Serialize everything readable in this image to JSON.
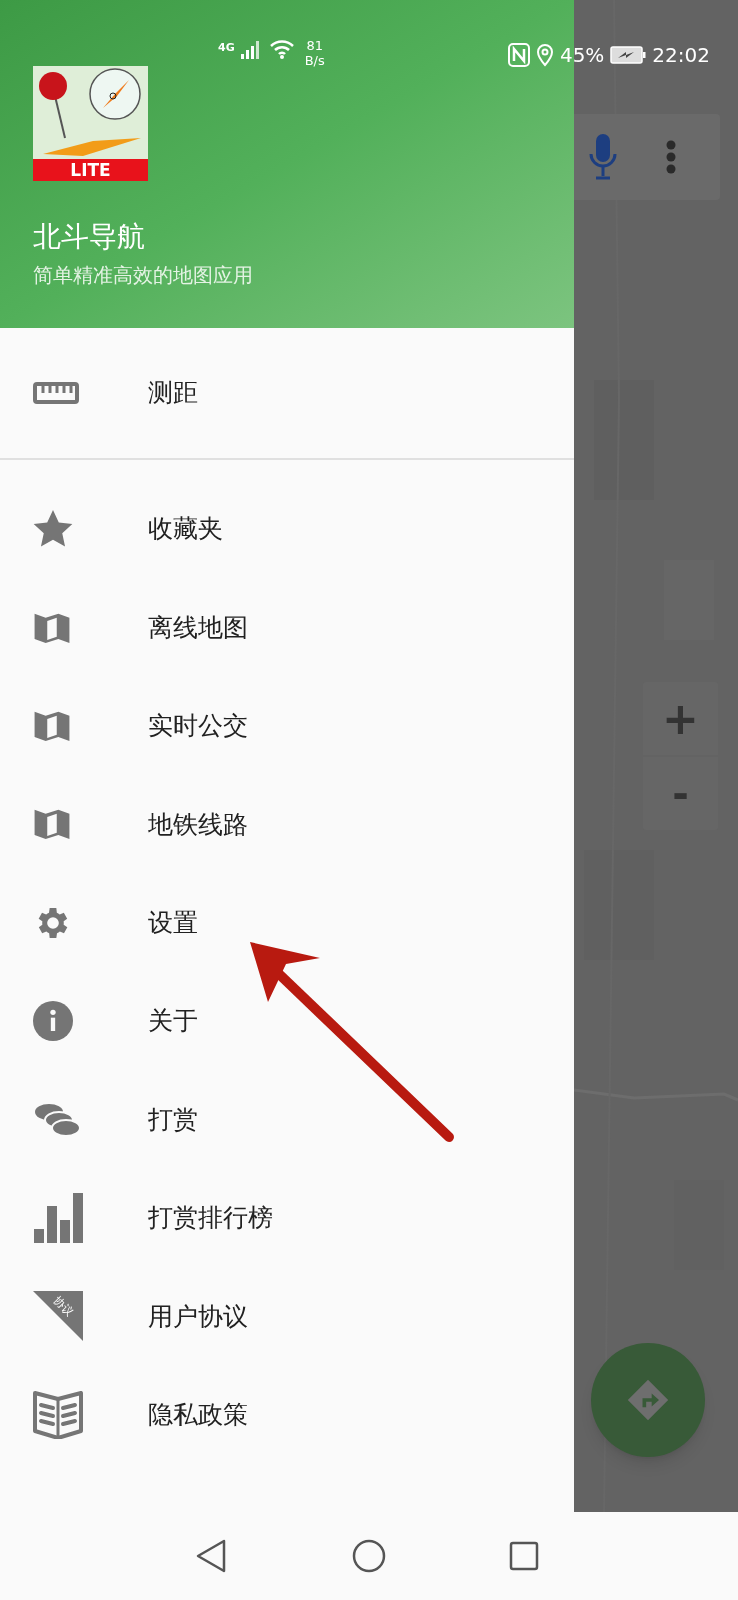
{
  "status_bar": {
    "network": "4G",
    "speed_value": "81",
    "speed_unit": "B/s",
    "battery": "45%",
    "time": "22:02"
  },
  "drawer": {
    "logo_badge": "LITE",
    "app_name": "北斗导航",
    "tagline": "简单精准高效的地图应用",
    "top_items": [
      {
        "label": "测距",
        "kind": "ruler"
      }
    ],
    "items": [
      {
        "label": "收藏夹",
        "kind": "star"
      },
      {
        "label": "离线地图",
        "kind": "map"
      },
      {
        "label": "实时公交",
        "kind": "map"
      },
      {
        "label": "地铁线路",
        "kind": "map"
      },
      {
        "label": "设置",
        "kind": "gear"
      },
      {
        "label": "关于",
        "kind": "info"
      },
      {
        "label": "打赏",
        "kind": "coins"
      },
      {
        "label": "打赏排行榜",
        "kind": "bars"
      },
      {
        "label": "用户协议",
        "kind": "agreement",
        "icon_text": "协议"
      },
      {
        "label": "隐私政策",
        "kind": "book"
      }
    ]
  },
  "map": {
    "zoom_in": "+",
    "zoom_out": "-"
  }
}
